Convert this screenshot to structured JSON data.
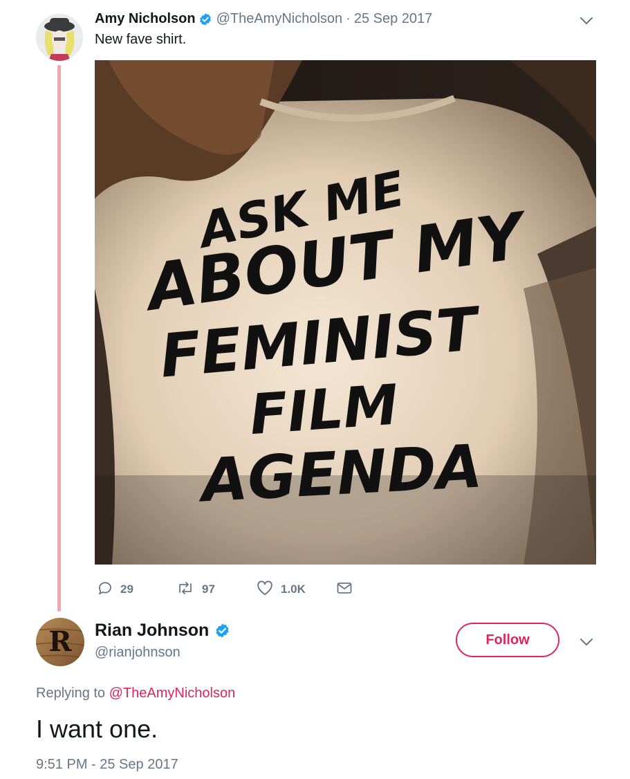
{
  "tweet1": {
    "name": "Amy Nicholson",
    "handle": "@TheAmyNicholson",
    "separator": "·",
    "date": "25 Sep 2017",
    "text": "New fave shirt.",
    "photo": {
      "shirt_text_line1": "ASK ME",
      "shirt_text_line2": "ABOUT MY",
      "shirt_text_line3": "FEMINIST",
      "shirt_text_line4": "FILM",
      "shirt_text_line5": "AGENDA"
    },
    "actions": {
      "replies": "29",
      "retweets": "97",
      "likes": "1.0K"
    }
  },
  "tweet2": {
    "name": "Rian Johnson",
    "handle": "@rianjohnson",
    "avatar_letter": "R",
    "follow_label": "Follow",
    "replying_prefix": "Replying to",
    "replying_to": "@TheAmyNicholson",
    "text": "I want one.",
    "timestamp": "9:51 PM - 25 Sep 2017"
  },
  "colors": {
    "accent": "#e0245e",
    "verified": "#1da1f2",
    "secondary_text": "#657786",
    "thread_line": "#f4a6ae"
  },
  "icons": [
    "verified-badge-icon",
    "chevron-down-icon",
    "reply-icon",
    "retweet-icon",
    "like-icon",
    "message-icon"
  ]
}
